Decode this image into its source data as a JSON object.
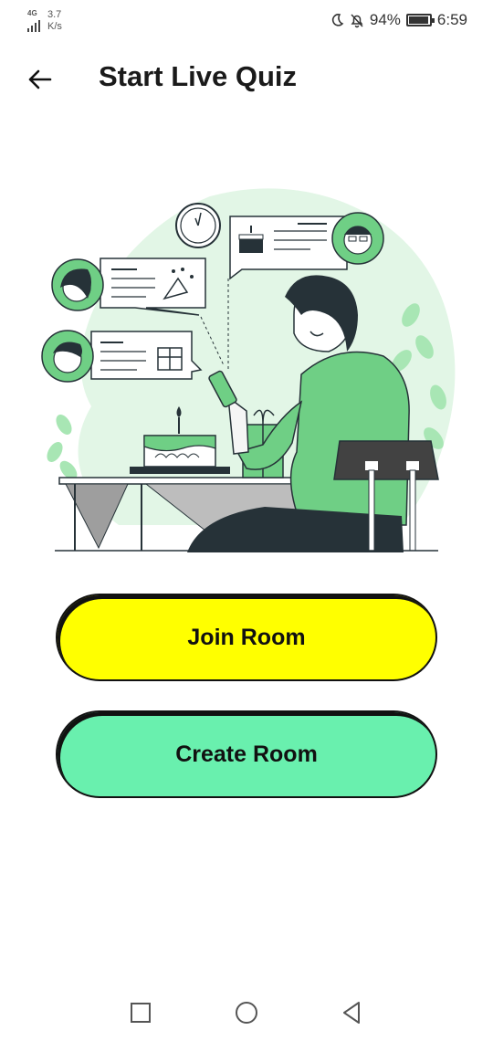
{
  "status_bar": {
    "network_type": "4G",
    "speed_value": "3.7",
    "speed_unit": "K/s",
    "battery": "94%",
    "battery_level": 0.94,
    "time": "6:59"
  },
  "header": {
    "title": "Start Live Quiz",
    "back_icon": "arrow-left-icon"
  },
  "illustration": {
    "subject": "man-using-phone-with-birthday-cake-icon",
    "accent_color": "#6fcf85"
  },
  "actions": {
    "join_label": "Join Room",
    "join_color": "#ffff00",
    "create_label": "Create Room",
    "create_color": "#69f0ae"
  },
  "nav": {
    "recents_icon": "square-icon",
    "home_icon": "circle-icon",
    "back_icon": "triangle-back-icon"
  }
}
